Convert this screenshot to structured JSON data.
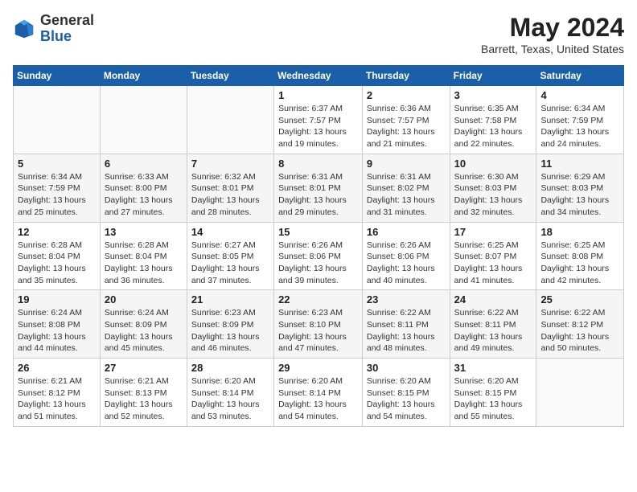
{
  "header": {
    "logo_general": "General",
    "logo_blue": "Blue",
    "title": "May 2024",
    "subtitle": "Barrett, Texas, United States"
  },
  "weekdays": [
    "Sunday",
    "Monday",
    "Tuesday",
    "Wednesday",
    "Thursday",
    "Friday",
    "Saturday"
  ],
  "weeks": [
    [
      {
        "day": "",
        "info": ""
      },
      {
        "day": "",
        "info": ""
      },
      {
        "day": "",
        "info": ""
      },
      {
        "day": "1",
        "info": "Sunrise: 6:37 AM\nSunset: 7:57 PM\nDaylight: 13 hours and 19 minutes."
      },
      {
        "day": "2",
        "info": "Sunrise: 6:36 AM\nSunset: 7:57 PM\nDaylight: 13 hours and 21 minutes."
      },
      {
        "day": "3",
        "info": "Sunrise: 6:35 AM\nSunset: 7:58 PM\nDaylight: 13 hours and 22 minutes."
      },
      {
        "day": "4",
        "info": "Sunrise: 6:34 AM\nSunset: 7:59 PM\nDaylight: 13 hours and 24 minutes."
      }
    ],
    [
      {
        "day": "5",
        "info": "Sunrise: 6:34 AM\nSunset: 7:59 PM\nDaylight: 13 hours and 25 minutes."
      },
      {
        "day": "6",
        "info": "Sunrise: 6:33 AM\nSunset: 8:00 PM\nDaylight: 13 hours and 27 minutes."
      },
      {
        "day": "7",
        "info": "Sunrise: 6:32 AM\nSunset: 8:01 PM\nDaylight: 13 hours and 28 minutes."
      },
      {
        "day": "8",
        "info": "Sunrise: 6:31 AM\nSunset: 8:01 PM\nDaylight: 13 hours and 29 minutes."
      },
      {
        "day": "9",
        "info": "Sunrise: 6:31 AM\nSunset: 8:02 PM\nDaylight: 13 hours and 31 minutes."
      },
      {
        "day": "10",
        "info": "Sunrise: 6:30 AM\nSunset: 8:03 PM\nDaylight: 13 hours and 32 minutes."
      },
      {
        "day": "11",
        "info": "Sunrise: 6:29 AM\nSunset: 8:03 PM\nDaylight: 13 hours and 34 minutes."
      }
    ],
    [
      {
        "day": "12",
        "info": "Sunrise: 6:28 AM\nSunset: 8:04 PM\nDaylight: 13 hours and 35 minutes."
      },
      {
        "day": "13",
        "info": "Sunrise: 6:28 AM\nSunset: 8:04 PM\nDaylight: 13 hours and 36 minutes."
      },
      {
        "day": "14",
        "info": "Sunrise: 6:27 AM\nSunset: 8:05 PM\nDaylight: 13 hours and 37 minutes."
      },
      {
        "day": "15",
        "info": "Sunrise: 6:26 AM\nSunset: 8:06 PM\nDaylight: 13 hours and 39 minutes."
      },
      {
        "day": "16",
        "info": "Sunrise: 6:26 AM\nSunset: 8:06 PM\nDaylight: 13 hours and 40 minutes."
      },
      {
        "day": "17",
        "info": "Sunrise: 6:25 AM\nSunset: 8:07 PM\nDaylight: 13 hours and 41 minutes."
      },
      {
        "day": "18",
        "info": "Sunrise: 6:25 AM\nSunset: 8:08 PM\nDaylight: 13 hours and 42 minutes."
      }
    ],
    [
      {
        "day": "19",
        "info": "Sunrise: 6:24 AM\nSunset: 8:08 PM\nDaylight: 13 hours and 44 minutes."
      },
      {
        "day": "20",
        "info": "Sunrise: 6:24 AM\nSunset: 8:09 PM\nDaylight: 13 hours and 45 minutes."
      },
      {
        "day": "21",
        "info": "Sunrise: 6:23 AM\nSunset: 8:09 PM\nDaylight: 13 hours and 46 minutes."
      },
      {
        "day": "22",
        "info": "Sunrise: 6:23 AM\nSunset: 8:10 PM\nDaylight: 13 hours and 47 minutes."
      },
      {
        "day": "23",
        "info": "Sunrise: 6:22 AM\nSunset: 8:11 PM\nDaylight: 13 hours and 48 minutes."
      },
      {
        "day": "24",
        "info": "Sunrise: 6:22 AM\nSunset: 8:11 PM\nDaylight: 13 hours and 49 minutes."
      },
      {
        "day": "25",
        "info": "Sunrise: 6:22 AM\nSunset: 8:12 PM\nDaylight: 13 hours and 50 minutes."
      }
    ],
    [
      {
        "day": "26",
        "info": "Sunrise: 6:21 AM\nSunset: 8:12 PM\nDaylight: 13 hours and 51 minutes."
      },
      {
        "day": "27",
        "info": "Sunrise: 6:21 AM\nSunset: 8:13 PM\nDaylight: 13 hours and 52 minutes."
      },
      {
        "day": "28",
        "info": "Sunrise: 6:20 AM\nSunset: 8:14 PM\nDaylight: 13 hours and 53 minutes."
      },
      {
        "day": "29",
        "info": "Sunrise: 6:20 AM\nSunset: 8:14 PM\nDaylight: 13 hours and 54 minutes."
      },
      {
        "day": "30",
        "info": "Sunrise: 6:20 AM\nSunset: 8:15 PM\nDaylight: 13 hours and 54 minutes."
      },
      {
        "day": "31",
        "info": "Sunrise: 6:20 AM\nSunset: 8:15 PM\nDaylight: 13 hours and 55 minutes."
      },
      {
        "day": "",
        "info": ""
      }
    ]
  ]
}
